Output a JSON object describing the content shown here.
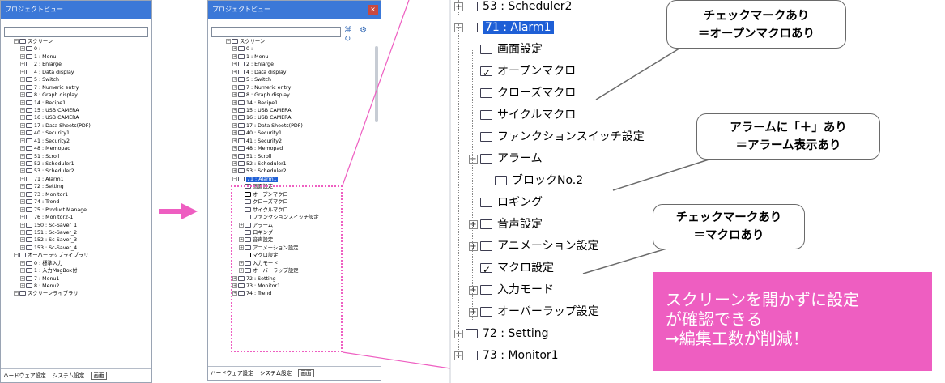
{
  "panel_title": "プロジェクトビュー",
  "close_glyph": "×",
  "tool_icons": "⌘ ⚙ ↻",
  "expand_glyph": "+",
  "collapse_glyph": "−",
  "bottom_tabs": [
    "ハードウェア設定",
    "システム設定",
    "画面"
  ],
  "left_tree": [
    {
      "label": "スクリーン",
      "depth": 0,
      "exp": "−"
    },
    {
      "label": "0 :",
      "depth": 1,
      "exp": "+"
    },
    {
      "label": "1 : Menu",
      "depth": 1,
      "exp": "+"
    },
    {
      "label": "2 : Enlarge",
      "depth": 1,
      "exp": "+"
    },
    {
      "label": "4 : Data display",
      "depth": 1,
      "exp": "+"
    },
    {
      "label": "5 : Switch",
      "depth": 1,
      "exp": "+"
    },
    {
      "label": "7 : Numeric entry",
      "depth": 1,
      "exp": "+"
    },
    {
      "label": "8 : Graph display",
      "depth": 1,
      "exp": "+"
    },
    {
      "label": "14 : Recipe1",
      "depth": 1,
      "exp": "+"
    },
    {
      "label": "15 : USB CAMERA",
      "depth": 1,
      "exp": "+"
    },
    {
      "label": "16 : USB CAMERA",
      "depth": 1,
      "exp": "+"
    },
    {
      "label": "17 : Data Sheets(PDF)",
      "depth": 1,
      "exp": "+"
    },
    {
      "label": "40 : Security1",
      "depth": 1,
      "exp": "+"
    },
    {
      "label": "41 : Security2",
      "depth": 1,
      "exp": "+"
    },
    {
      "label": "48 : Memopad",
      "depth": 1,
      "exp": "+"
    },
    {
      "label": "51 : Scroll",
      "depth": 1,
      "exp": "+"
    },
    {
      "label": "52 : Scheduler1",
      "depth": 1,
      "exp": "+"
    },
    {
      "label": "53 : Scheduler2",
      "depth": 1,
      "exp": "+"
    },
    {
      "label": "71 : Alarm1",
      "depth": 1,
      "exp": "+"
    },
    {
      "label": "72 : Setting",
      "depth": 1,
      "exp": "+"
    },
    {
      "label": "73 : Monitor1",
      "depth": 1,
      "exp": "+"
    },
    {
      "label": "74 : Trend",
      "depth": 1,
      "exp": "+"
    },
    {
      "label": "75 : Product Manage",
      "depth": 1,
      "exp": "+"
    },
    {
      "label": "76 : Monitor2-1",
      "depth": 1,
      "exp": "+"
    },
    {
      "label": "150 : Sc-Saver_1",
      "depth": 1,
      "exp": "+"
    },
    {
      "label": "151 : Sc-Saver_2",
      "depth": 1,
      "exp": "+"
    },
    {
      "label": "152 : Sc-Saver_3",
      "depth": 1,
      "exp": "+"
    },
    {
      "label": "153 : Sc-Saver_4",
      "depth": 1,
      "exp": "+"
    },
    {
      "label": "オーバーラップライブラリ",
      "depth": 0,
      "exp": "−"
    },
    {
      "label": "0 : 標準入力",
      "depth": 1,
      "exp": "+"
    },
    {
      "label": "1 : 入力MsgBox付",
      "depth": 1,
      "exp": "+"
    },
    {
      "label": "7 : Menu1",
      "depth": 1,
      "exp": "+"
    },
    {
      "label": "8 : Menu2",
      "depth": 1,
      "exp": "+"
    },
    {
      "label": "スクリーンライブラリ",
      "depth": 0,
      "exp": "−"
    }
  ],
  "mid_tree": [
    {
      "label": "スクリーン",
      "depth": 0,
      "exp": "−"
    },
    {
      "label": "0 :",
      "depth": 1,
      "exp": "+"
    },
    {
      "label": "1 : Menu",
      "depth": 1,
      "exp": "+"
    },
    {
      "label": "2 : Enlarge",
      "depth": 1,
      "exp": "+"
    },
    {
      "label": "4 : Data display",
      "depth": 1,
      "exp": "+"
    },
    {
      "label": "5 : Switch",
      "depth": 1,
      "exp": "+"
    },
    {
      "label": "7 : Numeric entry",
      "depth": 1,
      "exp": "+"
    },
    {
      "label": "8 : Graph display",
      "depth": 1,
      "exp": "+"
    },
    {
      "label": "14 : Recipe1",
      "depth": 1,
      "exp": "+"
    },
    {
      "label": "15 : USB CAMERA",
      "depth": 1,
      "exp": "+"
    },
    {
      "label": "16 : USB CAMERA",
      "depth": 1,
      "exp": "+"
    },
    {
      "label": "17 : Data Sheets(PDF)",
      "depth": 1,
      "exp": "+"
    },
    {
      "label": "40 : Security1",
      "depth": 1,
      "exp": "+"
    },
    {
      "label": "41 : Security2",
      "depth": 1,
      "exp": "+"
    },
    {
      "label": "48 : Memopad",
      "depth": 1,
      "exp": "+"
    },
    {
      "label": "51 : Scroll",
      "depth": 1,
      "exp": "+"
    },
    {
      "label": "52 : Scheduler1",
      "depth": 1,
      "exp": "+"
    },
    {
      "label": "53 : Scheduler2",
      "depth": 1,
      "exp": "+"
    },
    {
      "label": "71 : Alarm1",
      "depth": 1,
      "exp": "−",
      "selected": true
    },
    {
      "label": "画面設定",
      "depth": 2,
      "exp": ""
    },
    {
      "label": "オープンマクロ",
      "depth": 2,
      "exp": "",
      "check": true
    },
    {
      "label": "クローズマクロ",
      "depth": 2,
      "exp": ""
    },
    {
      "label": "サイクルマクロ",
      "depth": 2,
      "exp": ""
    },
    {
      "label": "ファンクションスイッチ設定",
      "depth": 2,
      "exp": ""
    },
    {
      "label": "アラーム",
      "depth": 2,
      "exp": "+"
    },
    {
      "label": "ロギング",
      "depth": 2,
      "exp": ""
    },
    {
      "label": "音声設定",
      "depth": 2,
      "exp": "+"
    },
    {
      "label": "アニメーション設定",
      "depth": 2,
      "exp": "+"
    },
    {
      "label": "マクロ設定",
      "depth": 2,
      "exp": "",
      "check": true
    },
    {
      "label": "入力モード",
      "depth": 2,
      "exp": "+"
    },
    {
      "label": "オーバーラップ設定",
      "depth": 2,
      "exp": "+"
    },
    {
      "label": "72 : Setting",
      "depth": 1,
      "exp": "+"
    },
    {
      "label": "73 : Monitor1",
      "depth": 1,
      "exp": "+"
    },
    {
      "label": "74 : Trend",
      "depth": 1,
      "exp": "+"
    }
  ],
  "big_tree": [
    {
      "label": "53 : Scheduler2",
      "depth": 0,
      "exp": "+"
    },
    {
      "label": "71 : Alarm1",
      "depth": 0,
      "exp": "−",
      "selected": true
    },
    {
      "label": "画面設定",
      "depth": 1,
      "exp": ""
    },
    {
      "label": "オープンマクロ",
      "depth": 1,
      "exp": "",
      "check": true
    },
    {
      "label": "クローズマクロ",
      "depth": 1,
      "exp": ""
    },
    {
      "label": "サイクルマクロ",
      "depth": 1,
      "exp": ""
    },
    {
      "label": "ファンクションスイッチ設定",
      "depth": 1,
      "exp": ""
    },
    {
      "label": "アラーム",
      "depth": 1,
      "exp": "−"
    },
    {
      "label": "ブロックNo.2",
      "depth": 2,
      "exp": ""
    },
    {
      "label": "ロギング",
      "depth": 1,
      "exp": ""
    },
    {
      "label": "音声設定",
      "depth": 1,
      "exp": "+"
    },
    {
      "label": "アニメーション設定",
      "depth": 1,
      "exp": "+"
    },
    {
      "label": "マクロ設定",
      "depth": 1,
      "exp": "",
      "check": true
    },
    {
      "label": "入力モード",
      "depth": 1,
      "exp": "+"
    },
    {
      "label": "オーバーラップ設定",
      "depth": 1,
      "exp": "+"
    },
    {
      "label": "72 : Setting",
      "depth": 0,
      "exp": "+"
    },
    {
      "label": "73 : Monitor1",
      "depth": 0,
      "exp": "+"
    }
  ],
  "callouts": [
    {
      "line1": "チェックマークあり",
      "line2": "＝オープンマクロあり"
    },
    {
      "line1": "アラームに「＋」あり",
      "line2": "＝アラーム表示あり"
    },
    {
      "line1": "チェックマークあり",
      "line2": "＝マクロあり"
    }
  ],
  "summary": {
    "line1": "スクリーンを開かずに設定",
    "line2": "が確認できる",
    "line3": "→編集工数が削減！"
  },
  "colors": {
    "accent": "#ee5ec1",
    "selection": "#1e5fd6",
    "title_bar": "#3b78d8",
    "close": "#c9493f"
  }
}
